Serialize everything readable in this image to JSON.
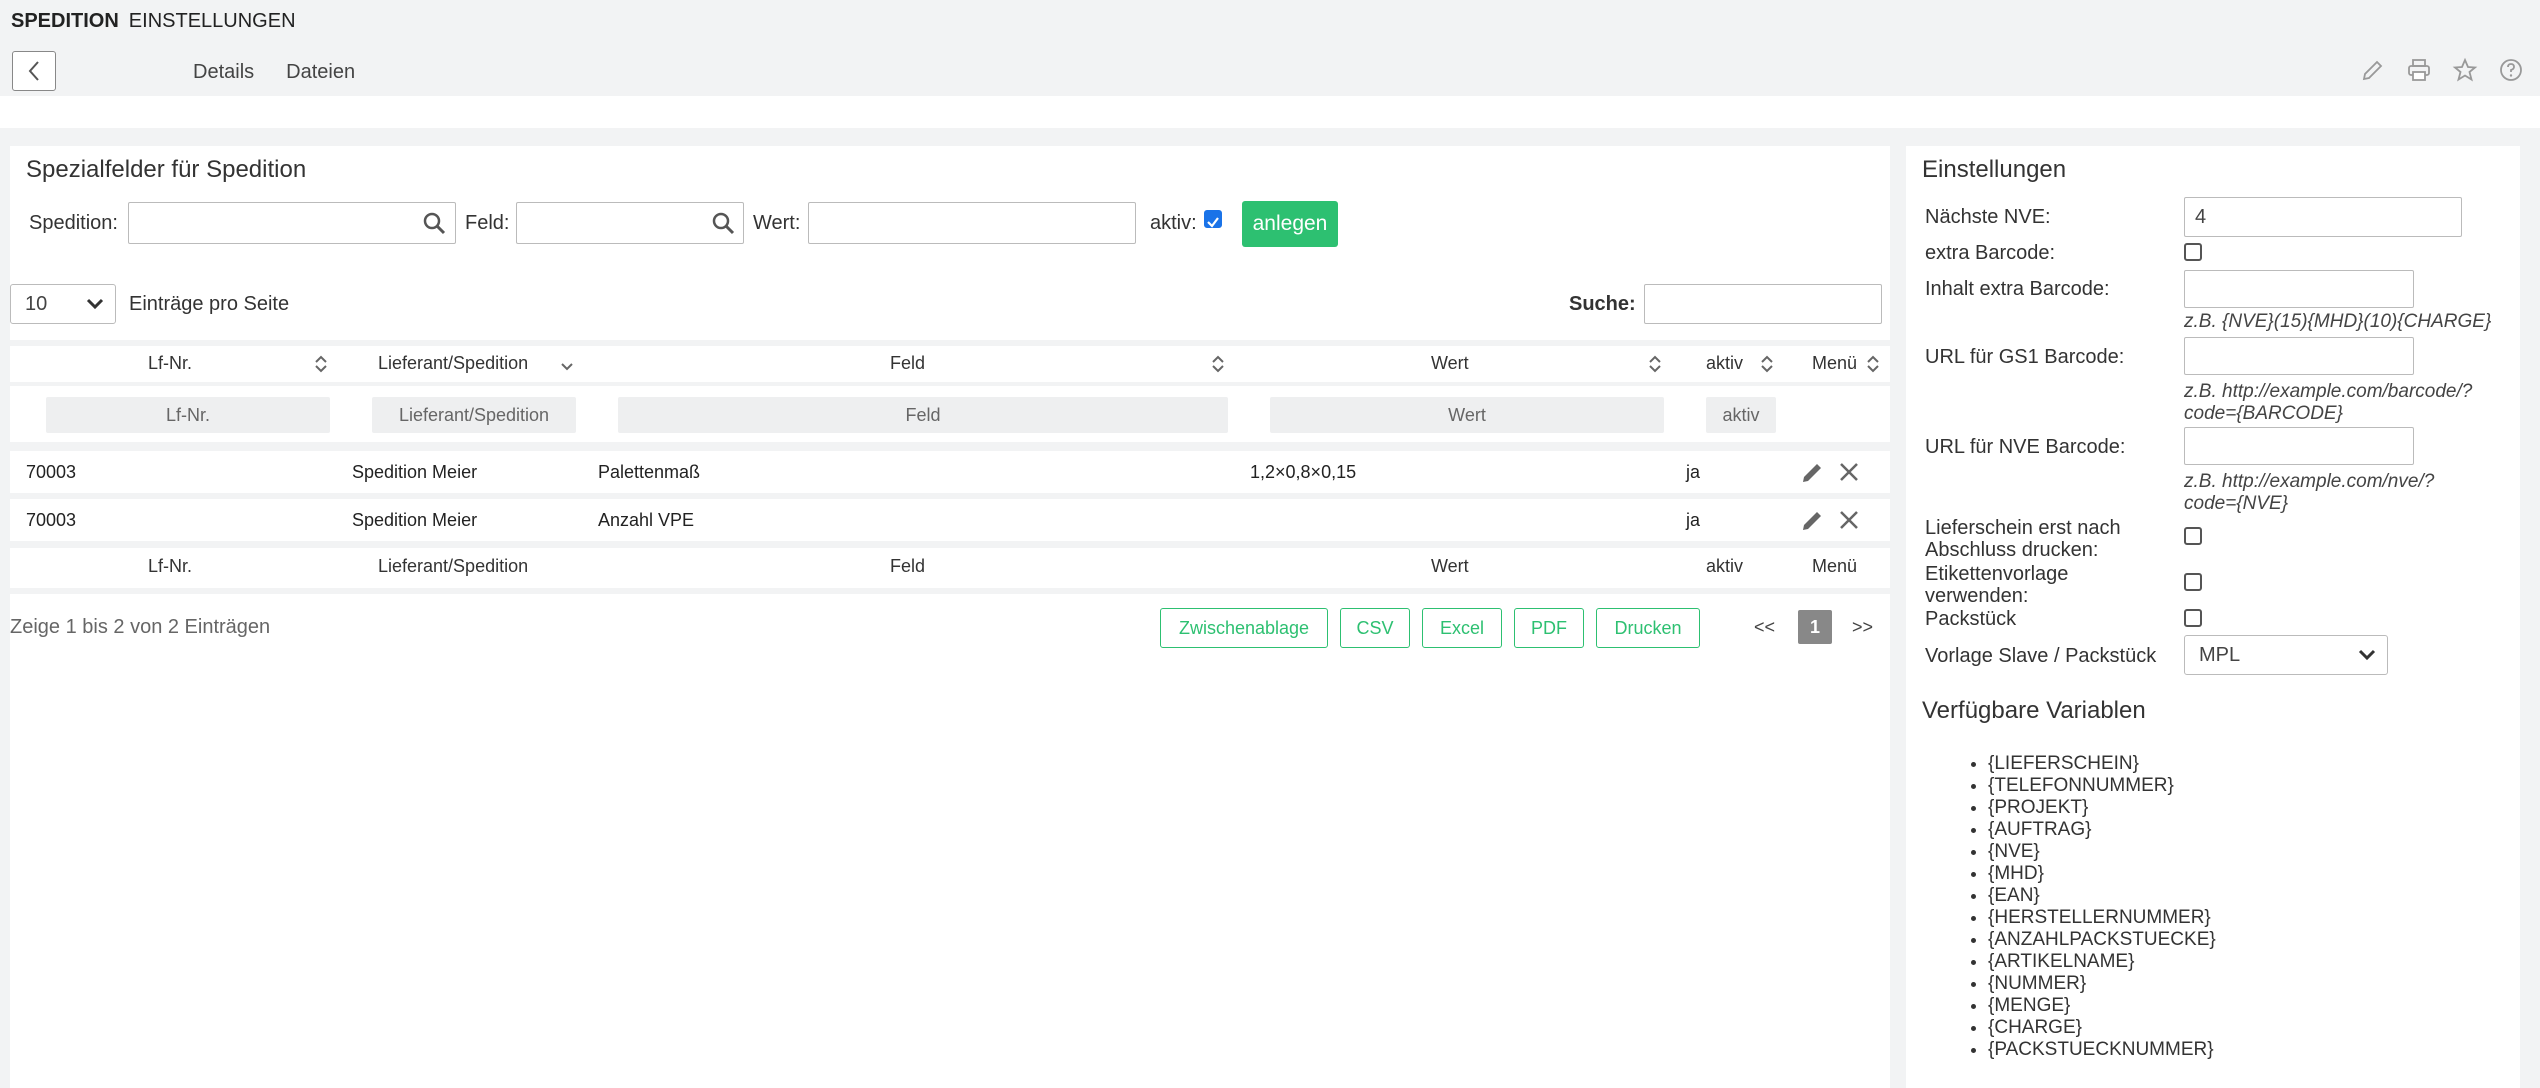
{
  "header": {
    "module": "SPEDITION",
    "section": "EINSTELLUNGEN",
    "tabs": [
      "Details",
      "Dateien"
    ]
  },
  "left": {
    "title": "Spezialfelder für Spedition",
    "form": {
      "spedition_label": "Spedition:",
      "feld_label": "Feld:",
      "wert_label": "Wert:",
      "aktiv_label": "aktiv:",
      "aktiv_checked": true,
      "create_button": "anlegen"
    },
    "page_size": "10",
    "page_size_label": "Einträge pro Seite",
    "search_label": "Suche:",
    "columns": [
      "Lf-Nr.",
      "Lieferant/Spedition",
      "Feld",
      "Wert",
      "aktiv",
      "Menü"
    ],
    "filters": [
      "Lf-Nr.",
      "Lieferant/Spedition",
      "Feld",
      "Wert",
      "aktiv"
    ],
    "rows": [
      {
        "lfnr": "70003",
        "lieferant": "Spedition Meier",
        "feld": "Palettenmaß",
        "wert": "1,2×0,8×0,15",
        "aktiv": "ja"
      },
      {
        "lfnr": "70003",
        "lieferant": "Spedition Meier",
        "feld": "Anzahl VPE",
        "wert": "",
        "aktiv": "ja"
      }
    ],
    "info": "Zeige 1 bis 2 von 2 Einträgen",
    "exports": [
      "Zwischenablage",
      "CSV",
      "Excel",
      "PDF",
      "Drucken"
    ],
    "pager": {
      "prev": "<<",
      "current": "1",
      "next": ">>"
    }
  },
  "right": {
    "title": "Einstellungen",
    "naechste_nve_label": "Nächste NVE:",
    "naechste_nve_value": "4",
    "extra_barcode_label": "extra Barcode:",
    "inhalt_extra_label": "Inhalt extra Barcode:",
    "inhalt_extra_hint": "z.B. {NVE}(15){MHD}(10){CHARGE}",
    "gs1_label": "URL für GS1 Barcode:",
    "gs1_hint_1": "z.B. http://example.com/barcode/?",
    "gs1_hint_2": "code={BARCODE}",
    "nve_label": "URL für NVE Barcode:",
    "nve_hint_1": "z.B. http://example.com/nve/?",
    "nve_hint_2": "code={NVE}",
    "lieferschein_label_1": "Lieferschein erst nach",
    "lieferschein_label_2": "Abschluss drucken:",
    "etiketten_label_1": "Etikettenvorlage",
    "etiketten_label_2": "verwenden:",
    "packstueck_label": "Packstück",
    "vorlage_label": "Vorlage Slave / Packstück",
    "vorlage_value": "MPL",
    "variables_title": "Verfügbare Variablen",
    "variables": [
      "{LIEFERSCHEIN}",
      "{TELEFONNUMMER}",
      "{PROJEKT}",
      "{AUFTRAG}",
      "{NVE}",
      "{MHD}",
      "{EAN}",
      "{HERSTELLERNUMMER}",
      "{ANZAHLPACKSTUECKE}",
      "{ARTIKELNAME}",
      "{NUMMER}",
      "{MENGE}",
      "{CHARGE}",
      "{PACKSTUECKNUMMER}"
    ]
  }
}
